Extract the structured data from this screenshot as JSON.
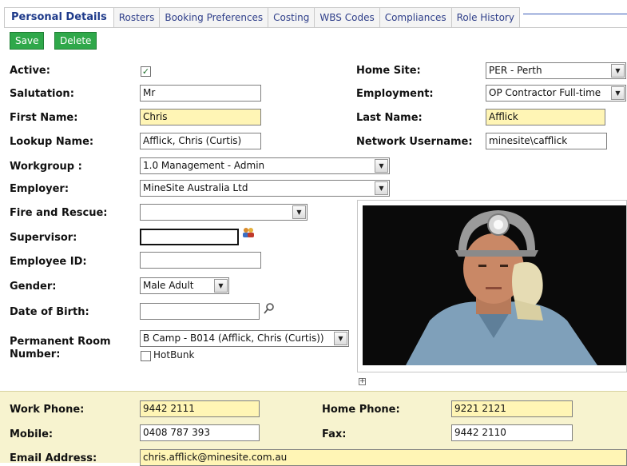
{
  "tabs": [
    {
      "label": "Personal Details"
    },
    {
      "label": "Rosters"
    },
    {
      "label": "Booking Preferences"
    },
    {
      "label": "Costing"
    },
    {
      "label": "WBS Codes"
    },
    {
      "label": "Compliances"
    },
    {
      "label": "Role History"
    }
  ],
  "toolbar": {
    "save_label": "Save",
    "delete_label": "Delete"
  },
  "form": {
    "active_label": "Active:",
    "active_checked": true,
    "home_site_label": "Home Site:",
    "home_site_value": "PER - Perth",
    "salutation_label": "Salutation:",
    "salutation_value": "Mr",
    "employment_label": "Employment:",
    "employment_value": "OP Contractor Full-time",
    "first_name_label": "First Name:",
    "first_name_value": "Chris",
    "last_name_label": "Last Name:",
    "last_name_value": "Afflick",
    "lookup_name_label": "Lookup Name:",
    "lookup_name_value": "Afflick, Chris (Curtis)",
    "network_username_label": "Network Username:",
    "network_username_value": "minesite\\cafflick",
    "workgroup_label": "Workgroup :",
    "workgroup_value": "1.0 Management - Admin",
    "employer_label": "Employer:",
    "employer_value": "MineSite Australia Ltd",
    "fire_rescue_label": "Fire and Rescue:",
    "fire_rescue_value": "",
    "supervisor_label": "Supervisor:",
    "supervisor_value": "",
    "employee_id_label": "Employee ID:",
    "employee_id_value": "",
    "gender_label": "Gender:",
    "gender_value": "Male Adult",
    "dob_label": "Date of Birth:",
    "dob_value": "",
    "room_label_1": "Permanent Room",
    "room_label_2": "Number:",
    "room_value": "B Camp - B014 (Afflick, Chris (Curtis))",
    "hotbunk_label": "HotBunk",
    "hotbunk_checked": false
  },
  "contact": {
    "work_phone_label": "Work Phone:",
    "work_phone_value": "9442 2111",
    "home_phone_label": "Home Phone:",
    "home_phone_value": "9221 2121",
    "mobile_label": "Mobile:",
    "mobile_value": "0408 787 393",
    "fax_label": "Fax:",
    "fax_value": "9442 2110",
    "email_label": "Email Address:",
    "email_value": "chris.afflick@minesite.com.au"
  },
  "icons": {
    "dropdown": "chevron-down-icon",
    "checkbox": "checkmark-icon",
    "people_picker": "people-picker-icon",
    "date_picker": "calendar-picker-icon",
    "expand": "expand-plus-icon"
  },
  "colors": {
    "accent_green": "#2fa84a",
    "required_yellow": "#fff5b5",
    "contact_band": "#f7f3cf",
    "tab_text": "#2f3f8a"
  }
}
